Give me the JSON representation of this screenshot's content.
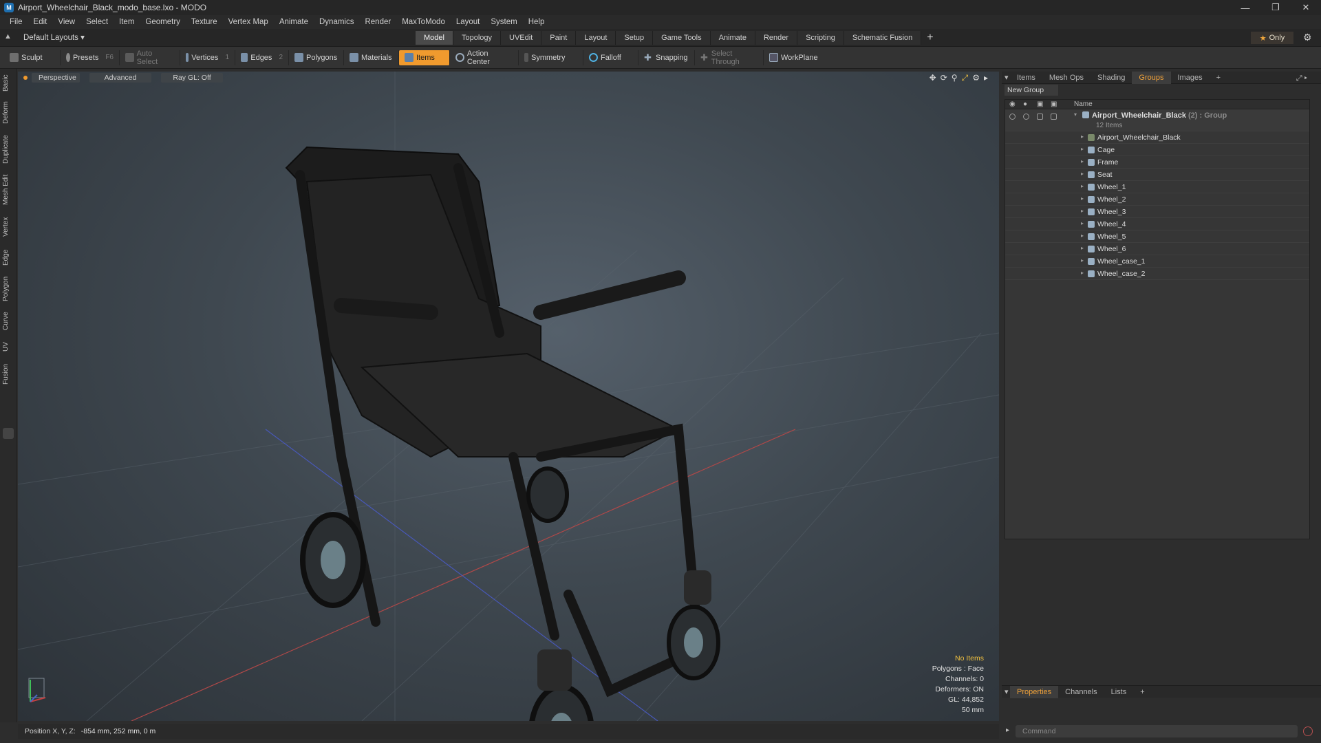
{
  "window": {
    "title": "Airport_Wheelchair_Black_modo_base.lxo - MODO",
    "app_icon": "modo-app-icon",
    "controls": [
      "minimize-icon",
      "restore-icon",
      "close-icon"
    ]
  },
  "menu": [
    "File",
    "Edit",
    "View",
    "Select",
    "Item",
    "Geometry",
    "Texture",
    "Vertex Map",
    "Animate",
    "Dynamics",
    "Render",
    "MaxToModo",
    "Layout",
    "System",
    "Help"
  ],
  "layout": {
    "dropdown": "Default Layouts ▾",
    "tabs": [
      "Model",
      "Topology",
      "UVEdit",
      "Paint",
      "Layout",
      "Setup",
      "Game Tools",
      "Animate",
      "Render",
      "Scripting",
      "Schematic Fusion"
    ],
    "active_tab": "Model",
    "only_label": "Only"
  },
  "toolbar": {
    "sculpt": "Sculpt",
    "presets": "Presets",
    "presets_key": "F6",
    "auto_select": "Auto Select",
    "vertices": "Vertices",
    "vertices_key": "1",
    "edges": "Edges",
    "edges_key": "2",
    "polygons": "Polygons",
    "materials": "Materials",
    "items": "Items",
    "action_center": "Action Center",
    "symmetry": "Symmetry",
    "falloff": "Falloff",
    "snapping": "Snapping",
    "select_through": "Select Through",
    "workplane": "WorkPlane"
  },
  "left_tabs": [
    "Basic",
    "Deform",
    "Duplicate",
    "Mesh Edit",
    "Vertex",
    "Edge",
    "Polygon",
    "Curve",
    "UV",
    "Fusion"
  ],
  "viewport": {
    "buttons": [
      "Perspective",
      "Advanced",
      "Ray GL: Off"
    ],
    "info": {
      "no_items": "No Items",
      "polygons": "Polygons : Face",
      "channels": "Channels: 0",
      "deformers": "Deformers: ON",
      "gl": "GL: 44,852",
      "scale": "50 mm"
    }
  },
  "status": {
    "label": "Position X, Y, Z:",
    "value": "-854 mm, 252 mm, 0 m"
  },
  "right_panel": {
    "tabs": [
      "Items",
      "Mesh Ops",
      "Shading",
      "Groups",
      "Images"
    ],
    "active_tab": "Groups",
    "new_group": "New Group",
    "column_name": "Name",
    "group": {
      "name": "Airport_Wheelchair_Black",
      "count": "(2)",
      "type": ": Group",
      "items_count": "12 Items"
    },
    "items": [
      "Airport_Wheelchair_Black",
      "Cage",
      "Frame",
      "Seat",
      "Wheel_1",
      "Wheel_2",
      "Wheel_3",
      "Wheel_4",
      "Wheel_5",
      "Wheel_6",
      "Wheel_case_1",
      "Wheel_case_2"
    ],
    "bottom_tabs": [
      "Properties",
      "Channels",
      "Lists"
    ],
    "bottom_active": "Properties",
    "command_placeholder": "Command"
  },
  "colors": {
    "accent": "#f09a2e",
    "active_tab_text": "#f0a23a"
  }
}
